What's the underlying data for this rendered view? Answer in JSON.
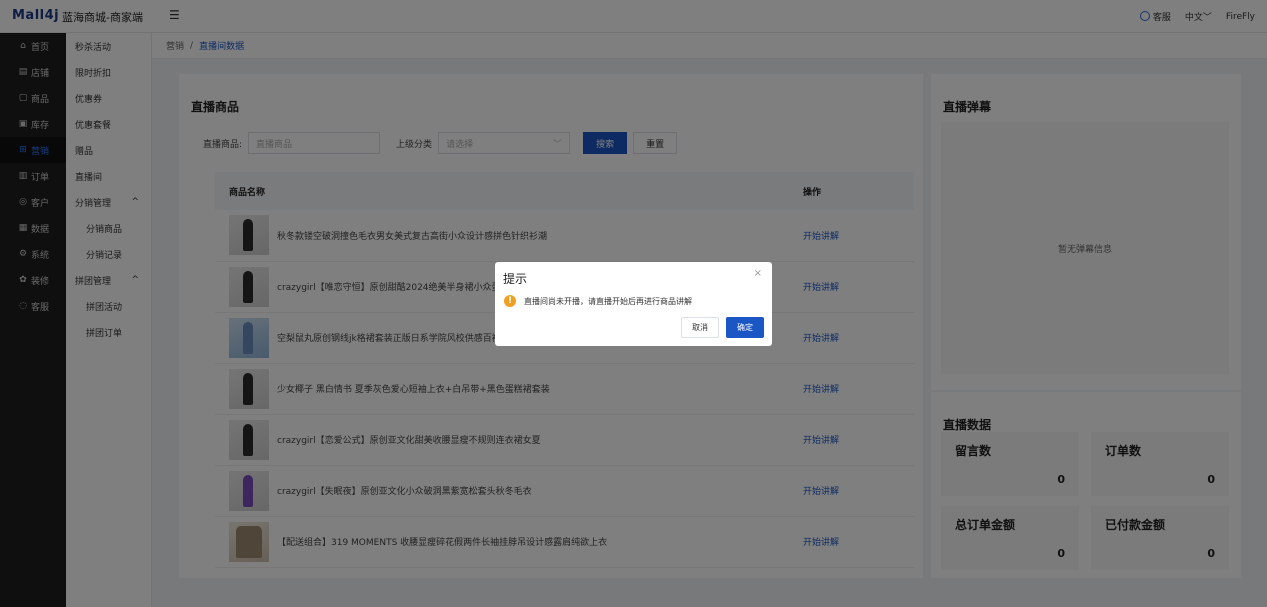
{
  "header": {
    "logo": "Mall4j",
    "title": "蓝海商城-商家端",
    "menu_toggle": "☰",
    "customer_service": "客服",
    "language": "中文",
    "user": "FireFly"
  },
  "nav": {
    "items": [
      {
        "icon": "⌂",
        "label": "首页"
      },
      {
        "icon": "▤",
        "label": "店铺"
      },
      {
        "icon": "▢",
        "label": "商品"
      },
      {
        "icon": "▣",
        "label": "库存"
      },
      {
        "icon": "⊞",
        "label": "营销"
      },
      {
        "icon": "▥",
        "label": "订单"
      },
      {
        "icon": "◎",
        "label": "客户"
      },
      {
        "icon": "▦",
        "label": "数据"
      },
      {
        "icon": "⚙",
        "label": "系统"
      },
      {
        "icon": "✿",
        "label": "装修"
      },
      {
        "icon": "◌",
        "label": "客服"
      }
    ]
  },
  "subnav": {
    "items": [
      "秒杀活动",
      "限时折扣",
      "优惠券",
      "优惠套餐",
      "赠品",
      "直播间"
    ],
    "group1": {
      "label": "分销管理",
      "arrow": "^",
      "items": [
        "分销商品",
        "分销记录"
      ]
    },
    "group2": {
      "label": "拼团管理",
      "arrow": "^",
      "items": [
        "拼团活动",
        "拼团订单"
      ]
    }
  },
  "breadcrumb": {
    "parent": "营销",
    "sep": "/",
    "current": "直播间数据"
  },
  "goods": {
    "title": "直播商品",
    "search_label": "直播商品:",
    "search_placeholder": "直播商品",
    "category_label": "上级分类",
    "category_placeholder": "请选择",
    "search_btn": "搜索",
    "reset_btn": "重置",
    "col_name": "商品名称",
    "col_op": "操作",
    "rows": [
      {
        "name": "秋冬款镂空破洞撞色毛衣男女美式复古高街小众设计感拼色针织衫潮",
        "op": "开始讲解"
      },
      {
        "name": "crazygirl【唯恋守恒】原创甜酷2024绝美半身裙小众蛋糕",
        "op": "开始讲解"
      },
      {
        "name": "空梨鼠丸原创钢线jk格裙套装正版日系学院风校供感百褶",
        "op": "开始讲解"
      },
      {
        "name": "少女椰子 黑白情书 夏季灰色爱心短袖上衣+白吊带+黑色蛋糕裙套装",
        "op": "开始讲解"
      },
      {
        "name": "crazygirl【恋爱公式】原创亚文化甜美收腰显瘦不规则连衣裙女夏",
        "op": "开始讲解"
      },
      {
        "name": "crazygirl【失眠夜】原创亚文化小众破洞黑紫宽松套头秋冬毛衣",
        "op": "开始讲解"
      },
      {
        "name": "【配送组合】319 MOMENTS 收腰显瘦碎花假两件长袖挂脖吊设计感露肩纯欲上衣",
        "op": "开始讲解"
      }
    ]
  },
  "barrage": {
    "title": "直播弹幕",
    "empty": "暂无弹幕信息"
  },
  "stats": {
    "title": "直播数据",
    "items": [
      {
        "label": "留言数",
        "value": "0"
      },
      {
        "label": "订单数",
        "value": "0"
      },
      {
        "label": "总订单金额",
        "value": "0"
      },
      {
        "label": "已付款金额",
        "value": "0"
      }
    ]
  },
  "dialog": {
    "title": "提示",
    "close": "×",
    "message": "直播间尚未开播，请直播开始后再进行商品讲解",
    "warn": "!",
    "cancel": "取消",
    "confirm": "确定"
  },
  "colors": {
    "primary": "#1a56c4",
    "warning": "#f0a020",
    "nav_bg": "#1f1f1f"
  }
}
